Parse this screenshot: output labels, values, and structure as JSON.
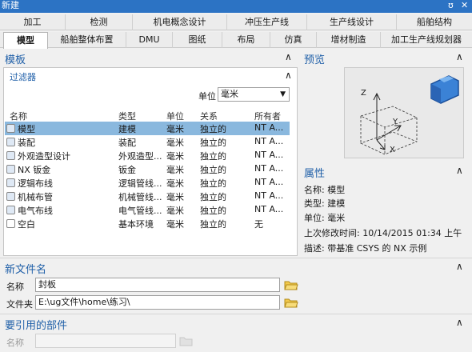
{
  "window": {
    "title": "新建",
    "help_glyph": "ʊ",
    "close_glyph": "✕"
  },
  "tabs_row1": [
    "加工",
    "检测",
    "机电概念设计",
    "冲压生产线",
    "生产线设计",
    "船舶结构"
  ],
  "tabs_row2": [
    "模型",
    "船舶整体布置",
    "DMU",
    "图纸",
    "布局",
    "仿真",
    "增材制造",
    "加工生产线规划器"
  ],
  "template": {
    "title": "模板",
    "filter_title": "过滤器",
    "unit_label": "单位",
    "unit_value": "毫米",
    "columns": [
      "名称",
      "类型",
      "单位",
      "关系",
      "所有者"
    ],
    "rows": [
      [
        "模型",
        "建模",
        "毫米",
        "独立的",
        "NT A..."
      ],
      [
        "装配",
        "装配",
        "毫米",
        "独立的",
        "NT A..."
      ],
      [
        "外观造型设计",
        "外观造型...",
        "毫米",
        "独立的",
        "NT A..."
      ],
      [
        "NX 钣金",
        "钣金",
        "毫米",
        "独立的",
        "NT A..."
      ],
      [
        "逻辑布线",
        "逻辑管线...",
        "毫米",
        "独立的",
        "NT A..."
      ],
      [
        "机械布管",
        "机械管线...",
        "毫米",
        "独立的",
        "NT A..."
      ],
      [
        "电气布线",
        "电气管线...",
        "毫米",
        "独立的",
        "NT A..."
      ],
      [
        "空白",
        "基本环境",
        "毫米",
        "独立的",
        "无"
      ]
    ]
  },
  "preview": {
    "title": "预览",
    "axis_x": "X",
    "axis_y": "Y",
    "axis_z": "Z"
  },
  "properties": {
    "title": "属性",
    "items": [
      "名称:  模型",
      "类型:  建模",
      "单位:  毫米",
      "上次修改时间:  10/14/2015 01:34 上午",
      "描述:  带基准 CSYS 的 NX 示例"
    ]
  },
  "new_file": {
    "title": "新文件名",
    "name_label": "名称",
    "name_value": "封板",
    "folder_label": "文件夹",
    "folder_value": "E:\\ug文件\\home\\练习\\"
  },
  "ref_part": {
    "title": "要引用的部件",
    "name_label": "名称"
  },
  "colors": {
    "accent": "#1f5fa8",
    "selected_row": "#8ab8de",
    "titlebar": "#2c73c4"
  }
}
